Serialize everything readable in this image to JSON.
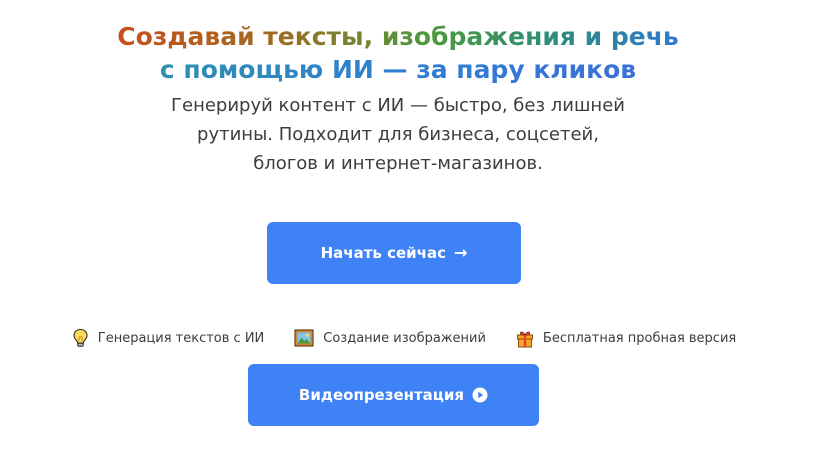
{
  "hero": {
    "title_line1": "Создавай тексты, изображения и речь",
    "title_line2": "с помощью ИИ — за пару кликов",
    "subtitle_lines": [
      "Генерируй контент с ИИ — быстро, без лишней",
      "рутины. Подходит для бизнеса, соцсетей,",
      "блогов и интернет-магазинов."
    ]
  },
  "cta": {
    "start_label": "Начать сейчас",
    "start_icon": "arrow-right-icon",
    "video_label": "Видеопрезентация",
    "video_icon": "play-circle-icon",
    "button_color": "#3e82f5"
  },
  "features": [
    {
      "icon": "lightbulb-icon",
      "label": "Генерация текстов с ИИ"
    },
    {
      "icon": "picture-icon",
      "label": "Создание изображений"
    },
    {
      "icon": "gift-icon",
      "label": "Бесплатная пробная версия"
    }
  ]
}
